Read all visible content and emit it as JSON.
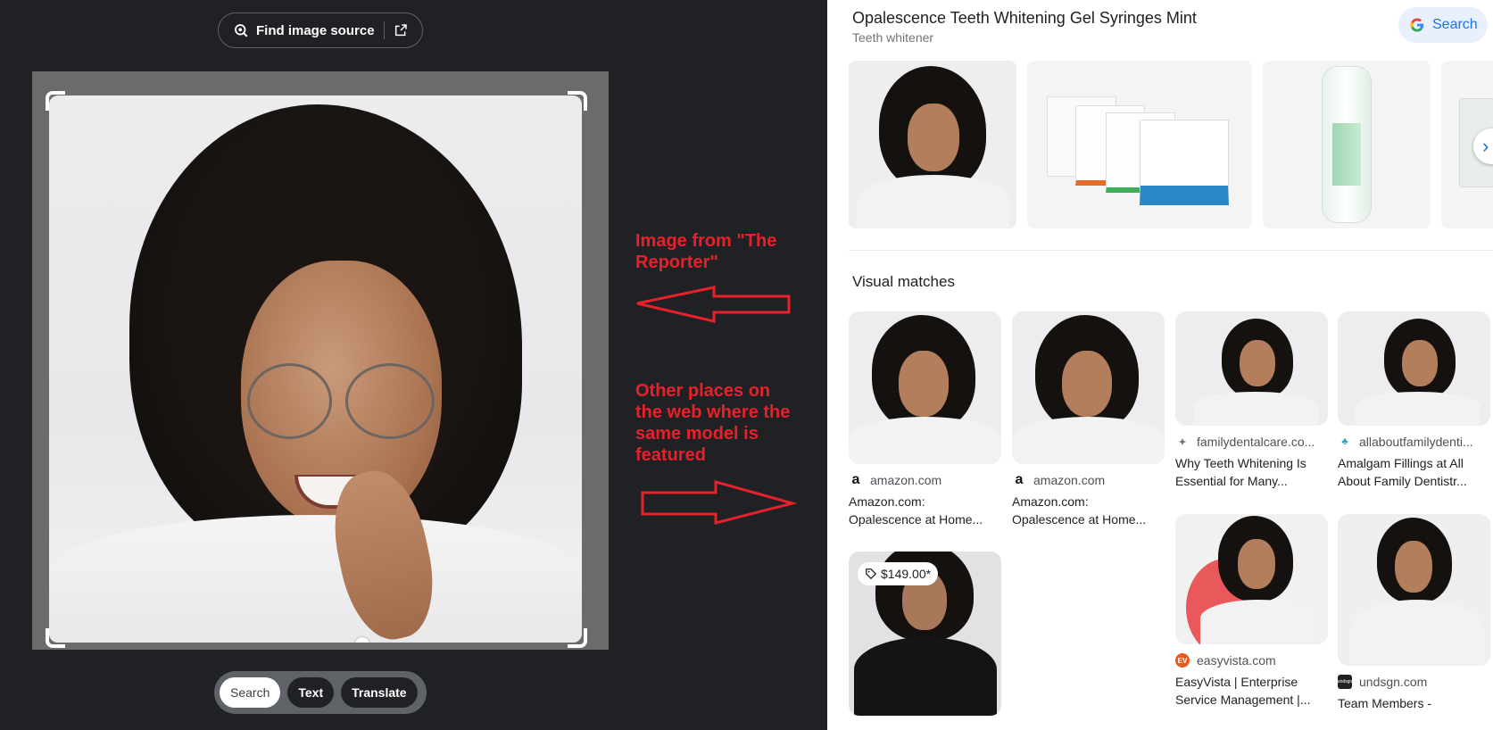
{
  "left_panel": {
    "find_source_label": "Find image source",
    "modes": [
      {
        "label": "Search",
        "active": true
      },
      {
        "label": "Text",
        "active": false
      },
      {
        "label": "Translate",
        "active": false
      }
    ]
  },
  "annotations": {
    "top": "Image from \"The Reporter\"",
    "bottom": "Other places on the web where the same model is featured",
    "color": "#e8202a"
  },
  "right_panel": {
    "title": "Opalescence Teeth Whitening Gel Syringes Mint",
    "subtitle": "Teeth whitener",
    "search_button_label": "Search",
    "products": [
      "model-photo",
      "product-boxes",
      "syringe-tube",
      "syringe-pack"
    ],
    "visual_matches_heading": "Visual matches",
    "matches": [
      {
        "source": "amazon.com",
        "title": "Amazon.com: Opalescence at Home...",
        "favicon": "amazon-icon"
      },
      {
        "source": "amazon.com",
        "title": "Amazon.com: Opalescence at Home...",
        "favicon": "amazon-icon"
      },
      {
        "source": "familydentalcare.co...",
        "title": "Why Teeth Whitening Is Essential for Many...",
        "favicon": "tooth-icon"
      },
      {
        "source": "allaboutfamilydenti...",
        "title": "Amalgam Fillings at All About Family Dentistr...",
        "favicon": "family-dental-icon"
      },
      {
        "source": "",
        "title": "",
        "price": "$149.00*"
      },
      {
        "source": "easyvista.com",
        "title": "EasyVista | Enterprise Service Management |...",
        "favicon": "easyvista-icon",
        "favicon_text": "EV"
      },
      {
        "source": "undsgn.com",
        "title": "Team Members -",
        "favicon": "undsgn-icon",
        "favicon_text": "undsgn"
      }
    ]
  },
  "colors": {
    "dark_bg": "#202124",
    "accent_blue": "#1a73e8",
    "search_chip_bg": "#e8f0fe"
  }
}
